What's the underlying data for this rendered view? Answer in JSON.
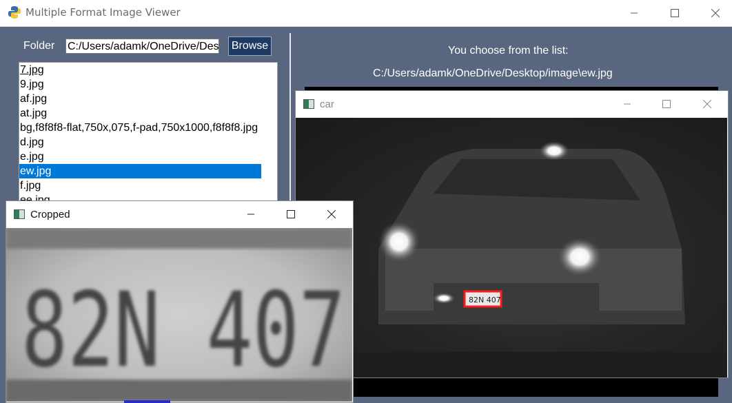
{
  "app": {
    "title": "Multiple Format Image Viewer",
    "controls": [
      "minimize",
      "maximize",
      "close"
    ]
  },
  "form": {
    "folder_label": "Folder",
    "folder_value": "C:/Users/adamk/OneDrive/Des",
    "browse_label": "Browse"
  },
  "file_list": {
    "items": [
      "7.jpg",
      "9.jpg",
      "af.jpg",
      "at.jpg",
      "bg,f8f8f8-flat,750x,075,f-pad,750x1000,f8f8f8.jpg",
      "d.jpg",
      "e.jpg",
      "ew.jpg",
      "f.jpg",
      "ee.jpg"
    ],
    "selected": "ew.jpg"
  },
  "selection": {
    "heading": "You choose from the list:",
    "path": "C:/Users/adamk/OneDrive/Desktop/image\\ew.jpg"
  },
  "car_window": {
    "title": "car",
    "plate_text": "82N 407"
  },
  "cropped_window": {
    "title": "Cropped",
    "plate_text": "82N 407"
  },
  "colors": {
    "background": "#58677f",
    "selection": "#0078d7",
    "browse_button": "#1f3a64",
    "plate_box": "#ff1a1a"
  }
}
